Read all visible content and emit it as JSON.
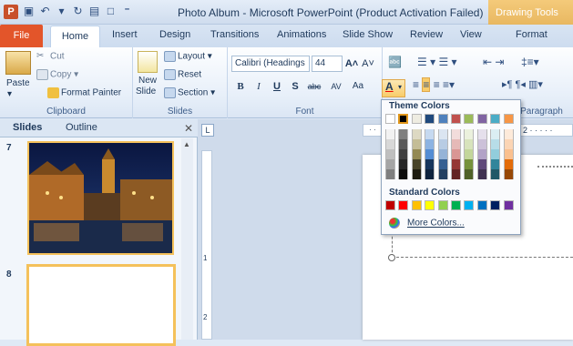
{
  "window": {
    "title": "Photo Album - Microsoft PowerPoint (Product Activation Failed)",
    "context_tab_title": "Drawing Tools"
  },
  "tabs": [
    "File",
    "Home",
    "Insert",
    "Design",
    "Transitions",
    "Animations",
    "Slide Show",
    "Review",
    "View",
    "Format"
  ],
  "clipboard": {
    "paste": "Paste",
    "cut": "Cut",
    "copy": "Copy",
    "format_painter": "Format Painter",
    "label": "Clipboard"
  },
  "slides_group": {
    "new_slide": "New",
    "new_slide2": "Slide",
    "layout": "Layout",
    "reset": "Reset",
    "section": "Section",
    "label": "Slides"
  },
  "font": {
    "name": "Calibri (Headings",
    "size": "44",
    "label": "Font",
    "bold": "B",
    "italic": "I",
    "underline": "U",
    "shadow": "S",
    "strike": "abc",
    "spacing": "AV",
    "case": "Aa",
    "color": "A"
  },
  "paragraph": {
    "label": "Paragraph"
  },
  "panel": {
    "slides_tab": "Slides",
    "outline_tab": "Outline",
    "slide7": "7",
    "slide8": "8"
  },
  "ruler": {
    "v1": "1",
    "v2": "2",
    "h2": "2"
  },
  "color_menu": {
    "theme_title": "Theme Colors",
    "standard_title": "Standard Colors",
    "more": "More Colors...",
    "theme_row": [
      "#ffffff",
      "#000000",
      "#eeece1",
      "#1f497d",
      "#4f81bd",
      "#c0504d",
      "#9bbb59",
      "#8064a2",
      "#4bacc6",
      "#f79646"
    ],
    "theme_shades": [
      [
        "#f2f2f2",
        "#7f7f7f",
        "#ddd9c3",
        "#c6d9f0",
        "#dbe5f1",
        "#f2dcdb",
        "#ebf1dd",
        "#e5e0ec",
        "#dbeef3",
        "#fdeada"
      ],
      [
        "#d8d8d8",
        "#595959",
        "#c4bd97",
        "#8db3e2",
        "#b8cce4",
        "#e5b9b7",
        "#d7e3bc",
        "#ccc1d9",
        "#b7dde8",
        "#fbd5b5"
      ],
      [
        "#bfbfbf",
        "#3f3f3f",
        "#938953",
        "#548dd4",
        "#95b3d7",
        "#d99694",
        "#c3d69b",
        "#b2a2c7",
        "#92cddc",
        "#fac08f"
      ],
      [
        "#a5a5a5",
        "#262626",
        "#494429",
        "#17365d",
        "#366092",
        "#953734",
        "#76923c",
        "#5f497a",
        "#31859b",
        "#e36c09"
      ],
      [
        "#7f7f7f",
        "#0c0c0c",
        "#1d1b10",
        "#0f243e",
        "#244061",
        "#632423",
        "#4f6128",
        "#3f3151",
        "#205867",
        "#974806"
      ]
    ],
    "standard_row": [
      "#c00000",
      "#ff0000",
      "#ffc000",
      "#ffff00",
      "#92d050",
      "#00b050",
      "#00b0f0",
      "#0070c0",
      "#002060",
      "#7030a0"
    ]
  }
}
